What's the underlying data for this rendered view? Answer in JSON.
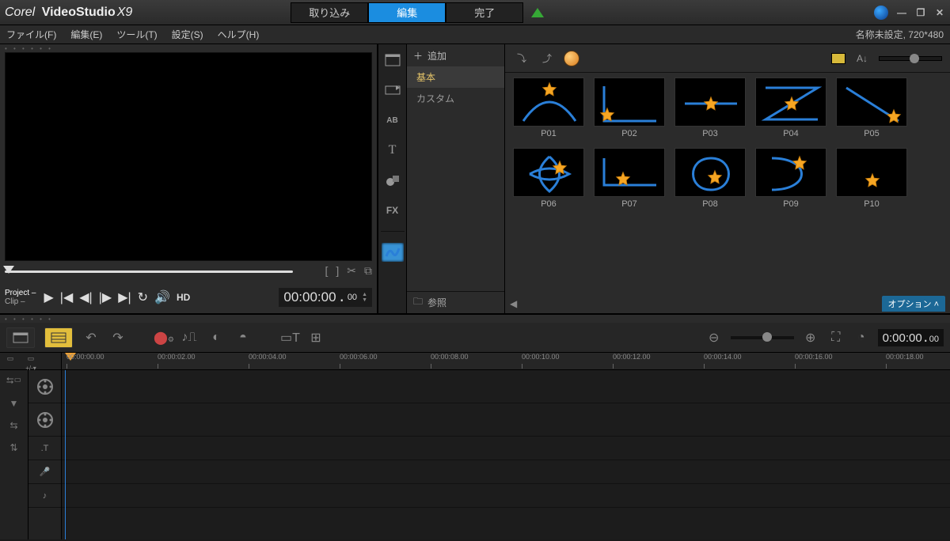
{
  "app": {
    "brand": "Corel",
    "product": "VideoStudio",
    "version": "X9"
  },
  "steps": {
    "capture": "取り込み",
    "edit": "編集",
    "share": "完了"
  },
  "menu": {
    "file": "ファイル(F)",
    "edit": "編集(E)",
    "tools": "ツール(T)",
    "settings": "設定(S)",
    "help": "ヘルプ(H)"
  },
  "project": {
    "status": "名称未設定, 720*480"
  },
  "preview": {
    "modeProject": "Project",
    "modeClip": "Clip",
    "hd": "HD",
    "timecode": "00:00:00",
    "frames": "00"
  },
  "library": {
    "addLabel": "追加",
    "cats": {
      "basic": "基本",
      "custom": "カスタム"
    },
    "browse": "参照",
    "options": "オプション",
    "tabFX": "FX",
    "tabT": "T",
    "tabAB": "AB",
    "items": [
      {
        "id": "P01"
      },
      {
        "id": "P02"
      },
      {
        "id": "P03"
      },
      {
        "id": "P04"
      },
      {
        "id": "P05"
      },
      {
        "id": "P06"
      },
      {
        "id": "P07"
      },
      {
        "id": "P08"
      },
      {
        "id": "P09"
      },
      {
        "id": "P10"
      }
    ]
  },
  "timeline": {
    "timecode": "0:00:00",
    "frames": "00",
    "ruler": [
      "00:00:00.00",
      "00:00:02.00",
      "00:00:04.00",
      "00:00:06.00",
      "00:00:08.00",
      "00:00:10.00",
      "00:00:12.00",
      "00:00:14.00",
      "00:00:16.00",
      "00:00:18.00"
    ]
  }
}
